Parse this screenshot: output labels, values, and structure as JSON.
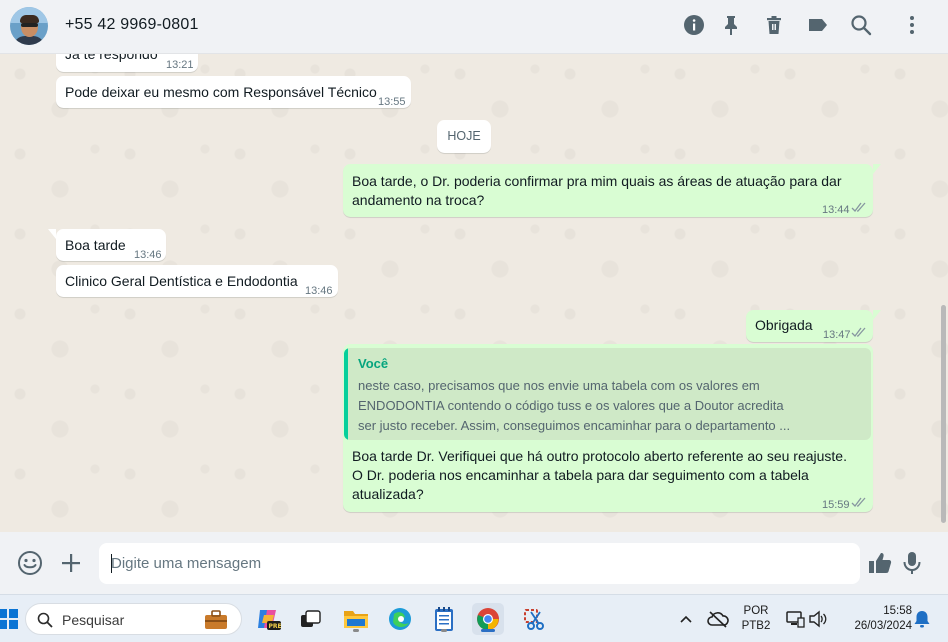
{
  "header": {
    "contact_name": "+55 42 9969-0801",
    "icons": [
      "info-icon",
      "pin-icon",
      "delete-icon",
      "label-icon",
      "search-icon",
      "menu-icon"
    ]
  },
  "messages": {
    "m1": {
      "text": "Já te respondo",
      "time": "13:21"
    },
    "m2": {
      "text": "Pode deixar eu mesmo com Responsável Técnico",
      "time": "13:55"
    },
    "day_label": "HOJE",
    "m3": {
      "line1": "Boa tarde, o Dr. poderia confirmar pra mim quais as áreas de atuação para dar",
      "line2": "andamento na troca?",
      "time": "13:44"
    },
    "m4": {
      "text": "Boa tarde",
      "time": "13:46"
    },
    "m5": {
      "text": "Clinico Geral Dentística e Endodontia",
      "time": "13:46"
    },
    "m6": {
      "text": "Obrigada",
      "time": "13:47"
    },
    "m7": {
      "quote_author": "Você",
      "quote_lines": [
        "neste caso, precisamos que nos envie uma tabela com os valores em",
        "ENDODONTIA contendo o código tuss e os valores que a Doutor acredita",
        "ser justo receber. Assim, conseguimos encaminhar para o departamento ..."
      ],
      "lines": [
        "Boa tarde Dr. Verifiquei que há outro protocolo aberto referente ao seu reajuste.",
        "O Dr. poderia nos encaminhar a tabela para dar seguimento com a tabela",
        "atualizada?"
      ],
      "time": "15:59"
    }
  },
  "composer": {
    "placeholder": "Digite uma mensagem"
  },
  "taskbar": {
    "search_label": "Pesquisar",
    "lang": "POR",
    "layout": "PTB2",
    "time": "15:58",
    "date": "26/03/2024"
  },
  "colors": {
    "incoming": "#ffffff",
    "outgoing": "#d9fdd3",
    "quote_accent": "#06cf9c",
    "background": "#efeae2"
  }
}
